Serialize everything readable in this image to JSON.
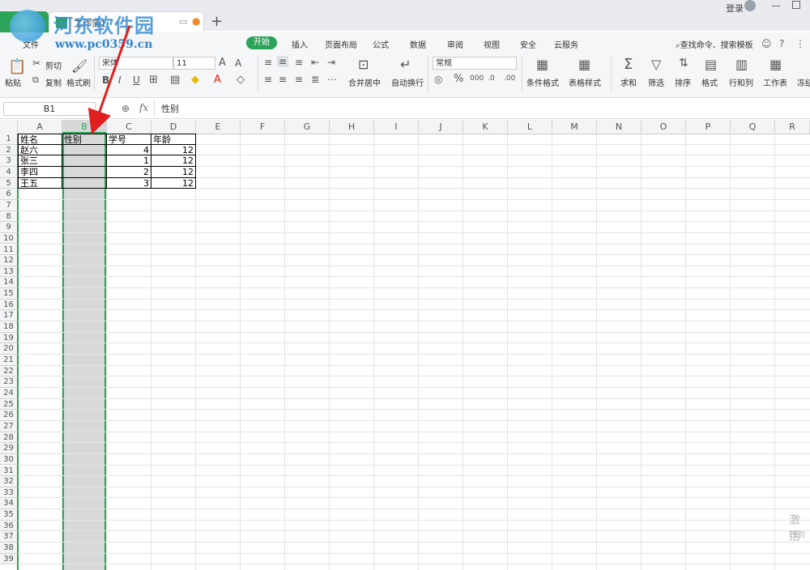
{
  "watermark": {
    "title": "河东软件园",
    "url": "www.pc0359.cn"
  },
  "titlebar": {
    "doc_tab": "工作簿1",
    "login": "登录"
  },
  "menu": {
    "items": [
      "文件",
      "开始",
      "插入",
      "页面布局",
      "公式",
      "数据",
      "审阅",
      "视图",
      "安全",
      "云服务"
    ],
    "search": "查找命令、搜索模板"
  },
  "ribbon": {
    "paste": "粘贴",
    "cut": "剪切",
    "copy": "复制",
    "format_painter": "格式刷",
    "font_name": "宋体",
    "font_size": "11",
    "merge_center": "合并居中",
    "wrap_text": "自动换行",
    "number_format": "常规",
    "conditional_format": "条件格式",
    "table_style": "表格样式",
    "sum": "求和",
    "filter": "筛选",
    "sort": "排序",
    "format": "格式",
    "rows_cols": "行和列",
    "worksheet": "工作表",
    "freeze": "冻结"
  },
  "formula_bar": {
    "name_box": "B1",
    "fx": "fx",
    "content": "性别"
  },
  "columns": [
    "A",
    "B",
    "C",
    "D",
    "E",
    "F",
    "G",
    "H",
    "I",
    "J",
    "K",
    "L",
    "M",
    "N",
    "O",
    "P",
    "Q",
    "R"
  ],
  "rows": [
    "1",
    "2",
    "3",
    "4",
    "5",
    "6",
    "7",
    "8",
    "9",
    "10",
    "11",
    "12",
    "13",
    "14",
    "15",
    "16",
    "17",
    "18",
    "19",
    "20",
    "21",
    "22",
    "23",
    "24",
    "25",
    "26",
    "27",
    "28",
    "29",
    "30",
    "31",
    "32",
    "33",
    "34",
    "35",
    "36",
    "37",
    "38",
    "39"
  ],
  "sheet": {
    "headers": [
      "姓名",
      "性别",
      "学号",
      "年龄"
    ],
    "data": [
      [
        "赵六",
        "",
        "4",
        "12"
      ],
      [
        "张三",
        "",
        "1",
        "12"
      ],
      [
        "李四",
        "",
        "2",
        "12"
      ],
      [
        "王五",
        "",
        "3",
        "12"
      ]
    ]
  },
  "activation": {
    "line1": "激活",
    "line2": "转到"
  },
  "colors": {
    "accent": "#2da35a",
    "selection": "#d9d9d9",
    "arrow": "#e02020"
  }
}
